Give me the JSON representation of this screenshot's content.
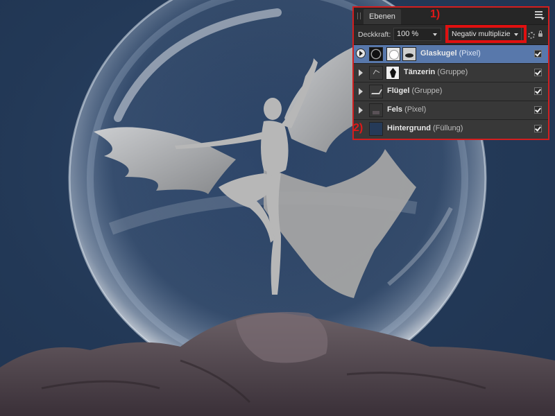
{
  "panel": {
    "tab_label": "Ebenen",
    "opacity_label": "Deckkraft:",
    "opacity_value": "100 %",
    "blend_mode": "Negativ multiplizie"
  },
  "layers": [
    {
      "name": "Glaskugel",
      "kind": "(Pixel)",
      "selected": true,
      "visible": true
    },
    {
      "name": "Tänzerin",
      "kind": "(Gruppe)",
      "selected": false,
      "visible": true
    },
    {
      "name": "Flügel",
      "kind": "(Gruppe)",
      "selected": false,
      "visible": true
    },
    {
      "name": "Fels",
      "kind": "(Pixel)",
      "selected": false,
      "visible": true
    },
    {
      "name": "Hintergrund",
      "kind": "(Füllung)",
      "selected": false,
      "visible": true
    }
  ],
  "annotations": {
    "marker_1": "1)",
    "marker_2": "2)"
  },
  "colors": {
    "background": "#253a58",
    "selection": "#5878ab",
    "highlight_red": "#e01010"
  }
}
